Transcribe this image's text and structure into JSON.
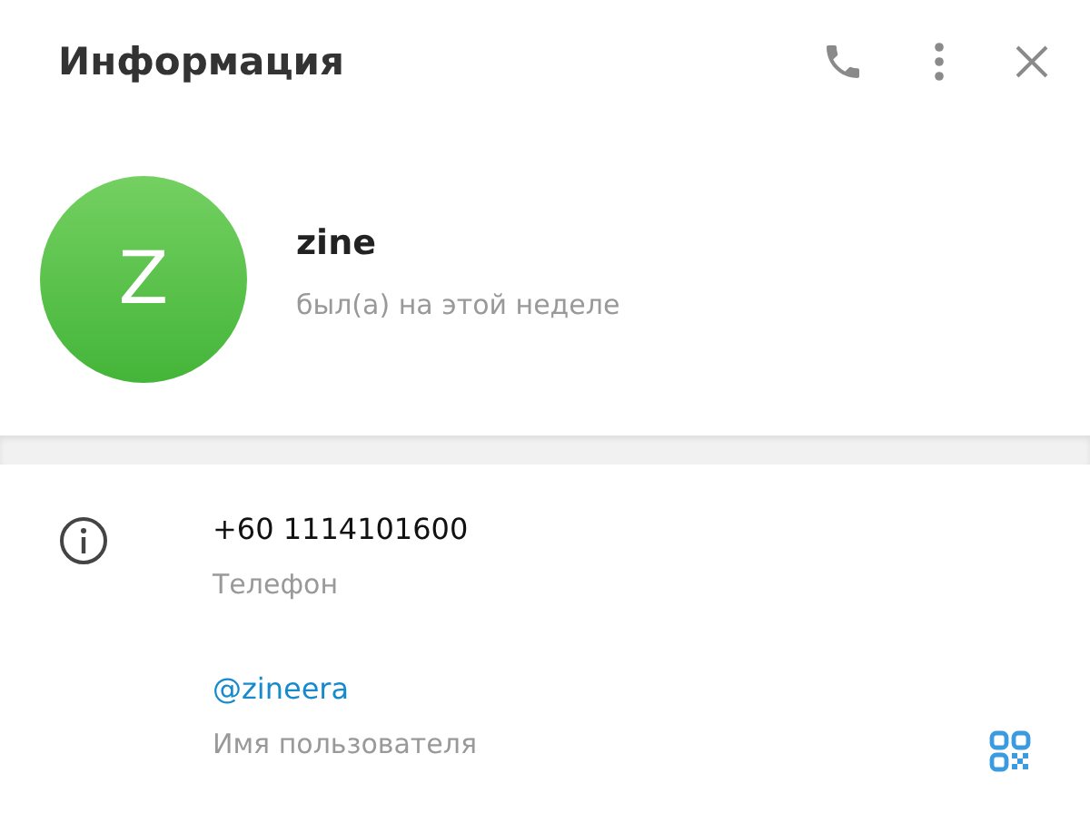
{
  "header": {
    "title": "Информация"
  },
  "profile": {
    "initial": "Z",
    "name": "zine",
    "status": "был(а) на этой неделе"
  },
  "info": [
    {
      "kind": "phone",
      "value": "+60 1114101600",
      "label": "Телефон"
    },
    {
      "kind": "username",
      "value": "@zineera",
      "label": "Имя пользователя"
    }
  ]
}
